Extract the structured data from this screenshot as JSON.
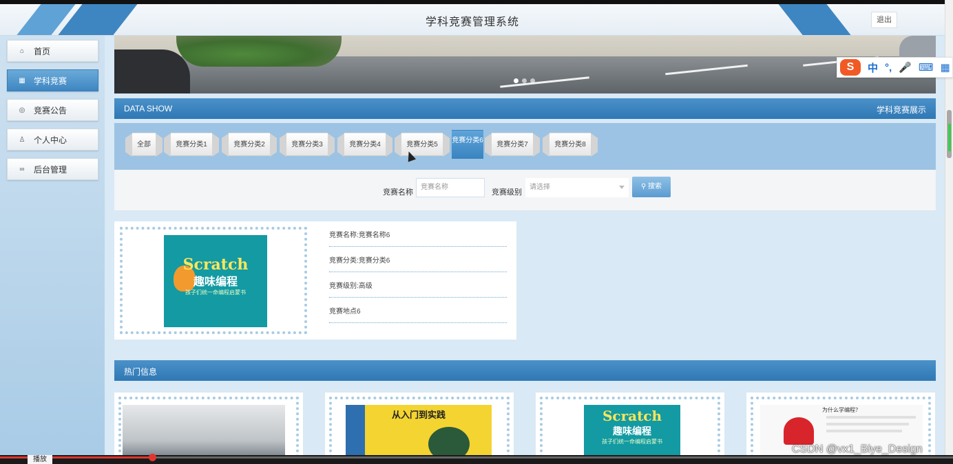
{
  "app": {
    "title": "学科竞赛管理系统",
    "logout": "退出"
  },
  "sidebar": {
    "items": [
      {
        "label": "首页",
        "icon": "home-icon",
        "glyph": "⌂"
      },
      {
        "label": "学科竞赛",
        "icon": "grid-icon",
        "glyph": "▦"
      },
      {
        "label": "竞赛公告",
        "icon": "announce-icon",
        "glyph": "◎"
      },
      {
        "label": "个人中心",
        "icon": "user-icon",
        "glyph": "♙"
      },
      {
        "label": "后台管理",
        "icon": "link-icon",
        "glyph": "∞"
      }
    ],
    "active_index": 1
  },
  "data_show": {
    "left": "DATA SHOW",
    "right": "学科竞赛展示"
  },
  "tabs": [
    "全部",
    "竞赛分类1",
    "竞赛分类2",
    "竞赛分类3",
    "竞赛分类4",
    "竞赛分类5",
    "竞赛分类6",
    "竞赛分类7",
    "竞赛分类8"
  ],
  "active_tab": 6,
  "search": {
    "name_label": "竞赛名称",
    "name_placeholder": "竞赛名称",
    "level_label": "竞赛级别",
    "level_placeholder": "请选择",
    "button": "搜索"
  },
  "result": {
    "rows": [
      "竞赛名称:竞赛名称6",
      "竞赛分类:竞赛分类6",
      "竞赛级别:高级",
      "竞赛地点6"
    ],
    "book": {
      "line1": "Scratch",
      "line2": "趣味编程",
      "line3": "孩子们统一命编程启蒙书"
    }
  },
  "hot": {
    "title": "热门信息",
    "cards": [
      {
        "caption": ""
      },
      {
        "caption": "从入门到实践"
      },
      {
        "caption": "Scratch 趣味编程"
      },
      {
        "caption": "为什么学编程？"
      }
    ]
  },
  "ime": {
    "brand": "S",
    "mode": "中"
  },
  "player": {
    "label": "播放",
    "progress": 0.16
  },
  "watermark": "CSDN @vx1_Biye_Design",
  "colors": {
    "accent": "#3e86c2",
    "sidebar": "#a8cbe6",
    "active_tab": "#3a84c0"
  }
}
